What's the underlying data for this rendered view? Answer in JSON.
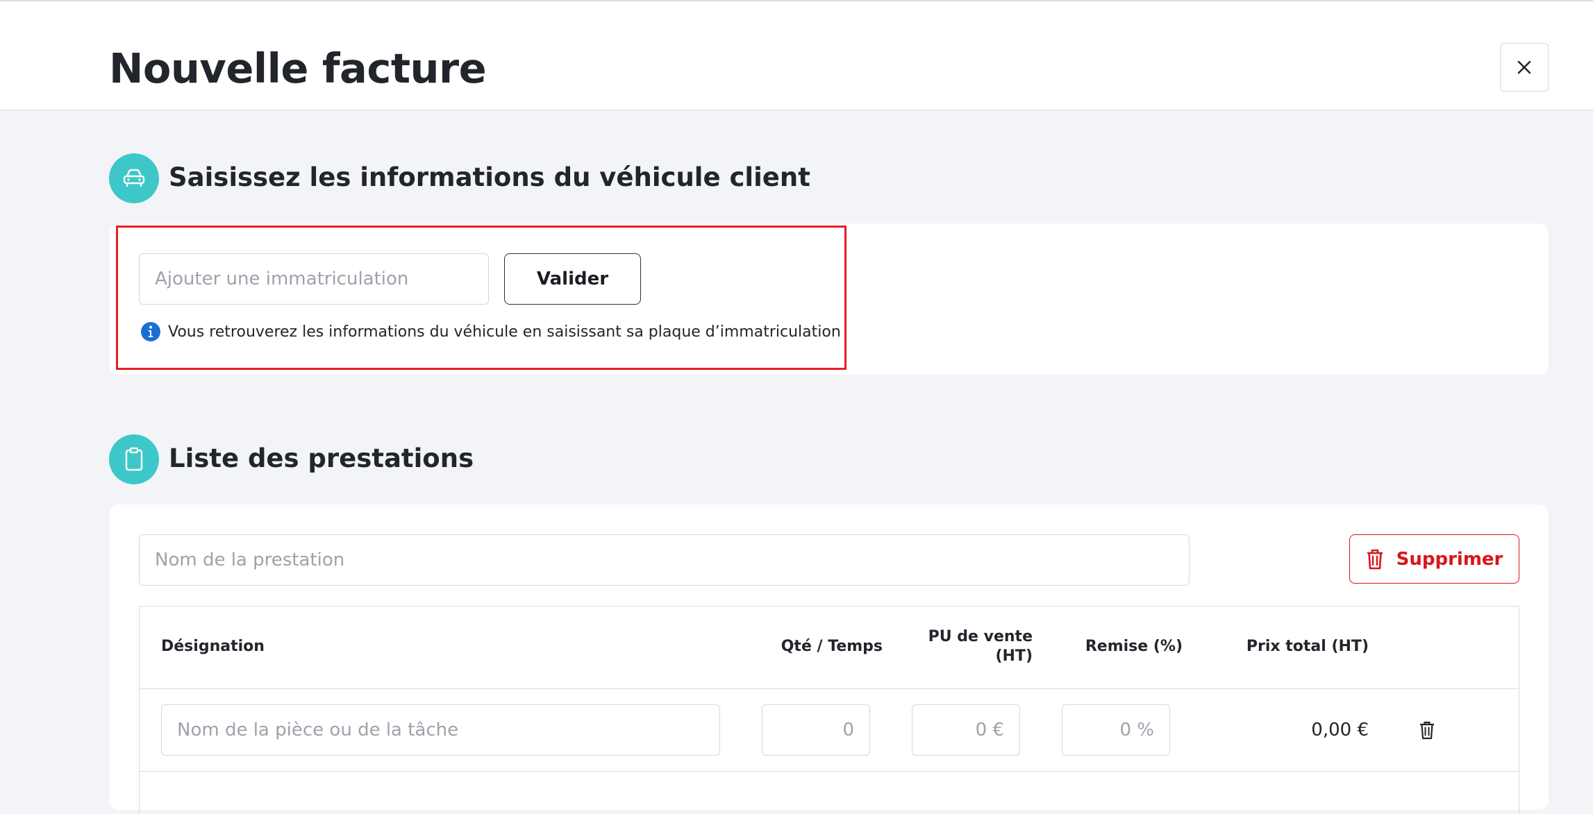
{
  "header": {
    "title": "Nouvelle facture"
  },
  "vehicle_section": {
    "title": "Saisissez les informations du véhicule client",
    "plate_input": {
      "placeholder": "Ajouter une immatriculation",
      "value": ""
    },
    "validate_button": "Valider",
    "info_text": "Vous retrouverez les informations du véhicule en saisissant sa plaque d’immatriculation"
  },
  "services_section": {
    "title": "Liste des prestations",
    "service_name_input": {
      "placeholder": "Nom de la prestation",
      "value": ""
    },
    "delete_button": "Supprimer",
    "table": {
      "headers": {
        "designation": "Désignation",
        "quantity": "Qté / Temps",
        "unit_price_line1": "PU de vente",
        "unit_price_line2": "(HT)",
        "discount": "Remise (%)",
        "total": "Prix total (HT)"
      },
      "rows": [
        {
          "designation_placeholder": "Nom de la pièce ou de la tâche",
          "quantity_placeholder": "0",
          "unit_price_placeholder": "0 €",
          "discount_placeholder": "0 %",
          "total": "0,00 €"
        }
      ]
    }
  },
  "colors": {
    "accent": "#3ec7c9",
    "danger": "#d9141a",
    "info": "#1a6fd6",
    "highlight": "#e51e25"
  }
}
